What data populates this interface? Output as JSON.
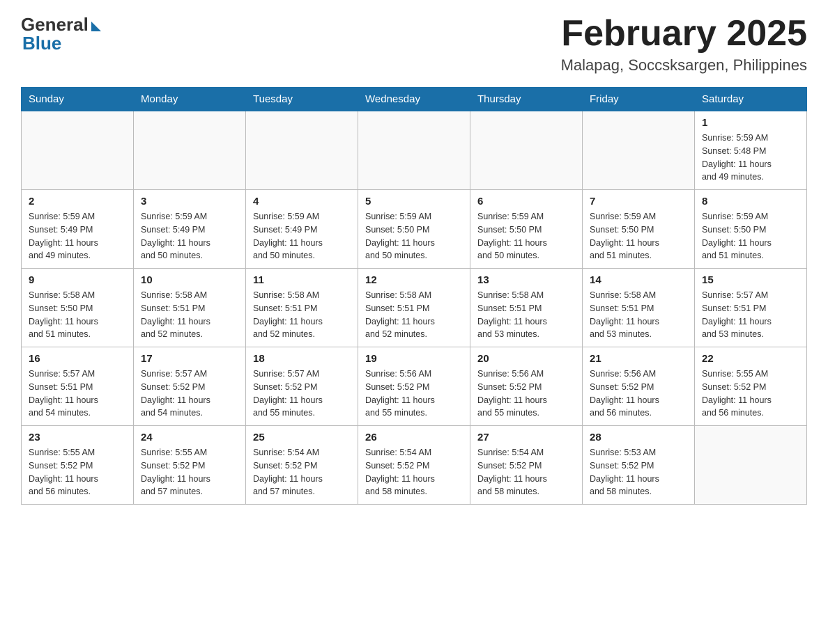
{
  "header": {
    "logo_general": "General",
    "logo_blue": "Blue",
    "month_title": "February 2025",
    "location": "Malapag, Soccsksargen, Philippines"
  },
  "days_of_week": [
    "Sunday",
    "Monday",
    "Tuesday",
    "Wednesday",
    "Thursday",
    "Friday",
    "Saturday"
  ],
  "weeks": [
    [
      {
        "day": "",
        "info": ""
      },
      {
        "day": "",
        "info": ""
      },
      {
        "day": "",
        "info": ""
      },
      {
        "day": "",
        "info": ""
      },
      {
        "day": "",
        "info": ""
      },
      {
        "day": "",
        "info": ""
      },
      {
        "day": "1",
        "info": "Sunrise: 5:59 AM\nSunset: 5:48 PM\nDaylight: 11 hours\nand 49 minutes."
      }
    ],
    [
      {
        "day": "2",
        "info": "Sunrise: 5:59 AM\nSunset: 5:49 PM\nDaylight: 11 hours\nand 49 minutes."
      },
      {
        "day": "3",
        "info": "Sunrise: 5:59 AM\nSunset: 5:49 PM\nDaylight: 11 hours\nand 50 minutes."
      },
      {
        "day": "4",
        "info": "Sunrise: 5:59 AM\nSunset: 5:49 PM\nDaylight: 11 hours\nand 50 minutes."
      },
      {
        "day": "5",
        "info": "Sunrise: 5:59 AM\nSunset: 5:50 PM\nDaylight: 11 hours\nand 50 minutes."
      },
      {
        "day": "6",
        "info": "Sunrise: 5:59 AM\nSunset: 5:50 PM\nDaylight: 11 hours\nand 50 minutes."
      },
      {
        "day": "7",
        "info": "Sunrise: 5:59 AM\nSunset: 5:50 PM\nDaylight: 11 hours\nand 51 minutes."
      },
      {
        "day": "8",
        "info": "Sunrise: 5:59 AM\nSunset: 5:50 PM\nDaylight: 11 hours\nand 51 minutes."
      }
    ],
    [
      {
        "day": "9",
        "info": "Sunrise: 5:58 AM\nSunset: 5:50 PM\nDaylight: 11 hours\nand 51 minutes."
      },
      {
        "day": "10",
        "info": "Sunrise: 5:58 AM\nSunset: 5:51 PM\nDaylight: 11 hours\nand 52 minutes."
      },
      {
        "day": "11",
        "info": "Sunrise: 5:58 AM\nSunset: 5:51 PM\nDaylight: 11 hours\nand 52 minutes."
      },
      {
        "day": "12",
        "info": "Sunrise: 5:58 AM\nSunset: 5:51 PM\nDaylight: 11 hours\nand 52 minutes."
      },
      {
        "day": "13",
        "info": "Sunrise: 5:58 AM\nSunset: 5:51 PM\nDaylight: 11 hours\nand 53 minutes."
      },
      {
        "day": "14",
        "info": "Sunrise: 5:58 AM\nSunset: 5:51 PM\nDaylight: 11 hours\nand 53 minutes."
      },
      {
        "day": "15",
        "info": "Sunrise: 5:57 AM\nSunset: 5:51 PM\nDaylight: 11 hours\nand 53 minutes."
      }
    ],
    [
      {
        "day": "16",
        "info": "Sunrise: 5:57 AM\nSunset: 5:51 PM\nDaylight: 11 hours\nand 54 minutes."
      },
      {
        "day": "17",
        "info": "Sunrise: 5:57 AM\nSunset: 5:52 PM\nDaylight: 11 hours\nand 54 minutes."
      },
      {
        "day": "18",
        "info": "Sunrise: 5:57 AM\nSunset: 5:52 PM\nDaylight: 11 hours\nand 55 minutes."
      },
      {
        "day": "19",
        "info": "Sunrise: 5:56 AM\nSunset: 5:52 PM\nDaylight: 11 hours\nand 55 minutes."
      },
      {
        "day": "20",
        "info": "Sunrise: 5:56 AM\nSunset: 5:52 PM\nDaylight: 11 hours\nand 55 minutes."
      },
      {
        "day": "21",
        "info": "Sunrise: 5:56 AM\nSunset: 5:52 PM\nDaylight: 11 hours\nand 56 minutes."
      },
      {
        "day": "22",
        "info": "Sunrise: 5:55 AM\nSunset: 5:52 PM\nDaylight: 11 hours\nand 56 minutes."
      }
    ],
    [
      {
        "day": "23",
        "info": "Sunrise: 5:55 AM\nSunset: 5:52 PM\nDaylight: 11 hours\nand 56 minutes."
      },
      {
        "day": "24",
        "info": "Sunrise: 5:55 AM\nSunset: 5:52 PM\nDaylight: 11 hours\nand 57 minutes."
      },
      {
        "day": "25",
        "info": "Sunrise: 5:54 AM\nSunset: 5:52 PM\nDaylight: 11 hours\nand 57 minutes."
      },
      {
        "day": "26",
        "info": "Sunrise: 5:54 AM\nSunset: 5:52 PM\nDaylight: 11 hours\nand 58 minutes."
      },
      {
        "day": "27",
        "info": "Sunrise: 5:54 AM\nSunset: 5:52 PM\nDaylight: 11 hours\nand 58 minutes."
      },
      {
        "day": "28",
        "info": "Sunrise: 5:53 AM\nSunset: 5:52 PM\nDaylight: 11 hours\nand 58 minutes."
      },
      {
        "day": "",
        "info": ""
      }
    ]
  ]
}
